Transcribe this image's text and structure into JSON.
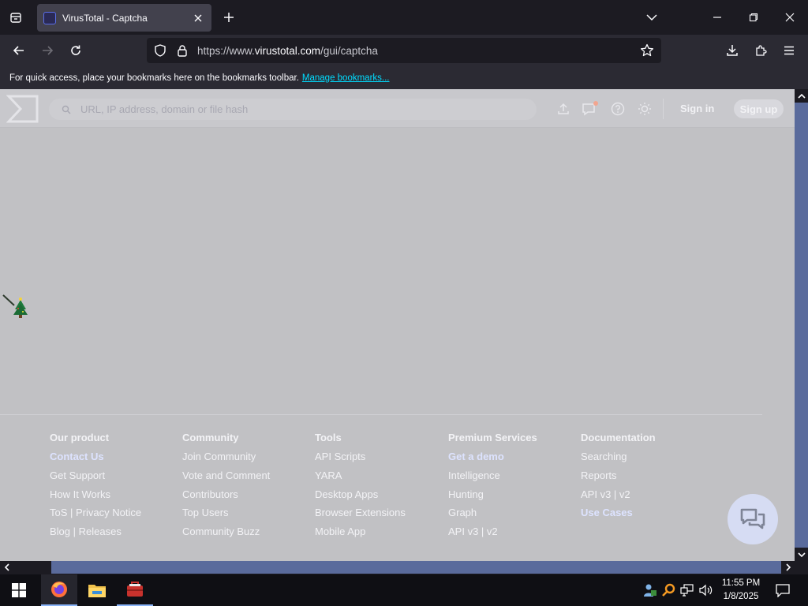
{
  "browser": {
    "tab_title": "VirusTotal - Captcha",
    "url_prefix": "https://www.",
    "url_domain": "virustotal.com",
    "url_path": "/gui/captcha",
    "bookmarks_message": "For quick access, place your bookmarks here on the bookmarks toolbar.",
    "bookmarks_link": "Manage bookmarks..."
  },
  "header": {
    "search_placeholder": "URL, IP address, domain or file hash",
    "sign_in": "Sign in",
    "sign_up": "Sign up"
  },
  "footer": {
    "columns": [
      {
        "title": "Our product",
        "links": [
          {
            "label": "Contact Us",
            "accent": true
          },
          {
            "label": "Get Support",
            "accent": false
          },
          {
            "label": "How It Works",
            "accent": false
          },
          {
            "label": "ToS | Privacy Notice",
            "accent": false
          },
          {
            "label": "Blog | Releases",
            "accent": false
          }
        ]
      },
      {
        "title": "Community",
        "links": [
          {
            "label": "Join Community",
            "accent": false
          },
          {
            "label": "Vote and Comment",
            "accent": false
          },
          {
            "label": "Contributors",
            "accent": false
          },
          {
            "label": "Top Users",
            "accent": false
          },
          {
            "label": "Community Buzz",
            "accent": false
          }
        ]
      },
      {
        "title": "Tools",
        "links": [
          {
            "label": "API Scripts",
            "accent": false
          },
          {
            "label": "YARA",
            "accent": false
          },
          {
            "label": "Desktop Apps",
            "accent": false
          },
          {
            "label": "Browser Extensions",
            "accent": false
          },
          {
            "label": "Mobile App",
            "accent": false
          }
        ]
      },
      {
        "title": "Premium Services",
        "links": [
          {
            "label": "Get a demo",
            "accent": true
          },
          {
            "label": "Intelligence",
            "accent": false
          },
          {
            "label": "Hunting",
            "accent": false
          },
          {
            "label": "Graph",
            "accent": false
          },
          {
            "label": "API v3 | v2",
            "accent": false
          }
        ]
      },
      {
        "title": "Documentation",
        "links": [
          {
            "label": "Searching",
            "accent": false
          },
          {
            "label": "Reports",
            "accent": false
          },
          {
            "label": "API v3 | v2",
            "accent": false
          },
          {
            "label": "Use Cases",
            "accent": true
          }
        ]
      }
    ]
  },
  "taskbar": {
    "time": "11:55 PM",
    "date": "1/8/2025",
    "apps": [
      "firefox-icon",
      "file-explorer-icon",
      "toolbox-app-icon"
    ]
  },
  "colors": {
    "accent_link": "#dde3ff",
    "taskbar_indicator": "#8ab4f8",
    "scrollbar": "#5a6b9c"
  }
}
